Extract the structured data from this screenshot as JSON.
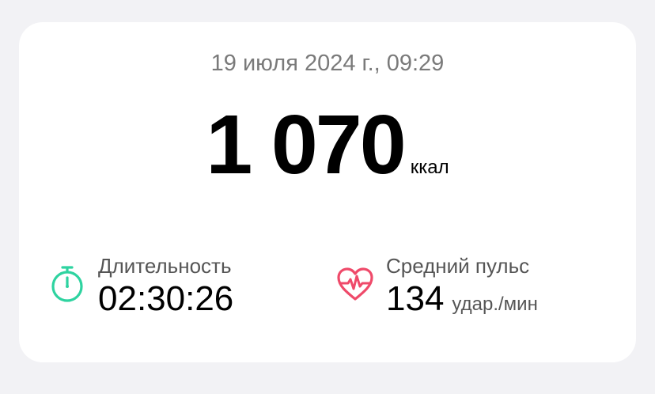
{
  "workout": {
    "date": "19 июля 2024 г., 09:29",
    "calories_value": "1 070",
    "calories_unit": "ккал"
  },
  "stats": {
    "duration": {
      "label": "Длительность",
      "value": "02:30:26",
      "icon": "stopwatch-icon"
    },
    "pulse": {
      "label": "Средний пульс",
      "value": "134",
      "unit": "удар./мин",
      "icon": "heart-pulse-icon"
    }
  },
  "colors": {
    "duration_icon": "#2ed3a0",
    "pulse_icon": "#ef4a6a",
    "background": "#f2f2f5",
    "card": "#ffffff"
  }
}
